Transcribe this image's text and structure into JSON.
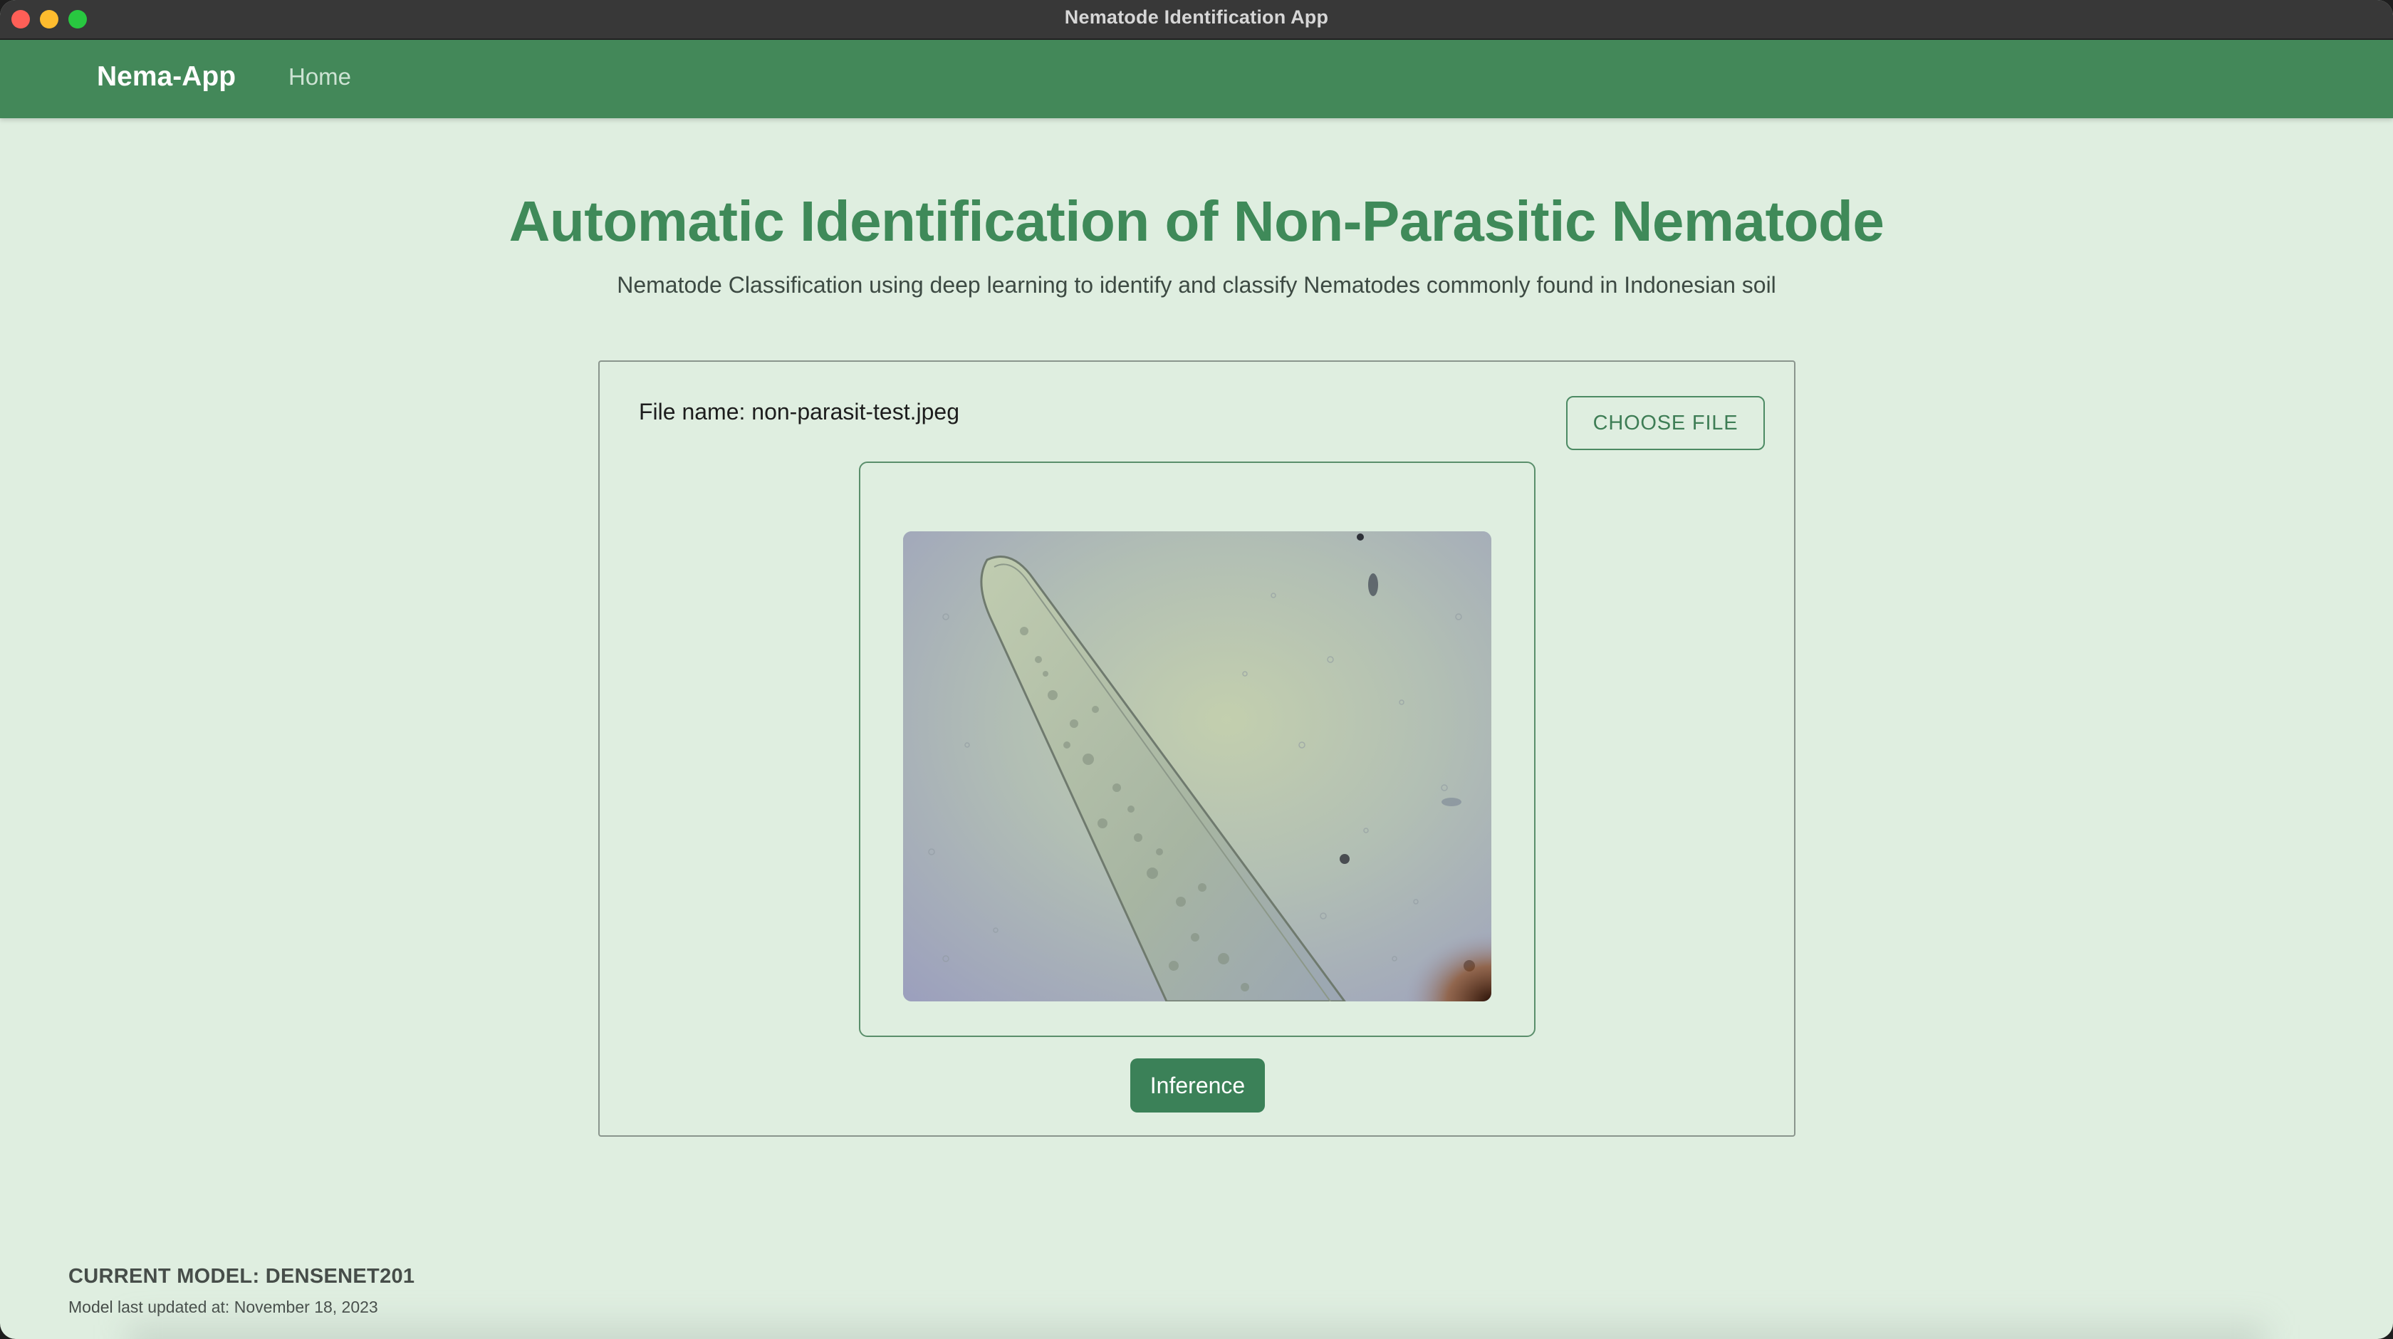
{
  "window": {
    "title": "Nematode Identification App"
  },
  "navbar": {
    "brand": "Nema-App",
    "home_label": "Home"
  },
  "main": {
    "title": "Automatic Identification of Non-Parasitic Nematode",
    "subtitle": "Nematode Classification using deep learning to identify and classify Nematodes commonly found in Indonesian soil"
  },
  "upload": {
    "file_name_text": "File name: non-parasit-test.jpeg",
    "choose_file_label": "CHOOSE FILE",
    "inference_label": "Inference"
  },
  "footer": {
    "current_model": "CURRENT MODEL: DENSENET201",
    "last_updated": "Model last updated at: November 18, 2023"
  },
  "colors": {
    "navbar": "#438859",
    "accent": "#3f8a59",
    "background": "#dfeee0",
    "button_primary": "#3b8158"
  },
  "icons": {
    "close": "close-window-icon",
    "minimize": "minimize-window-icon",
    "maximize": "maximize-window-icon"
  }
}
